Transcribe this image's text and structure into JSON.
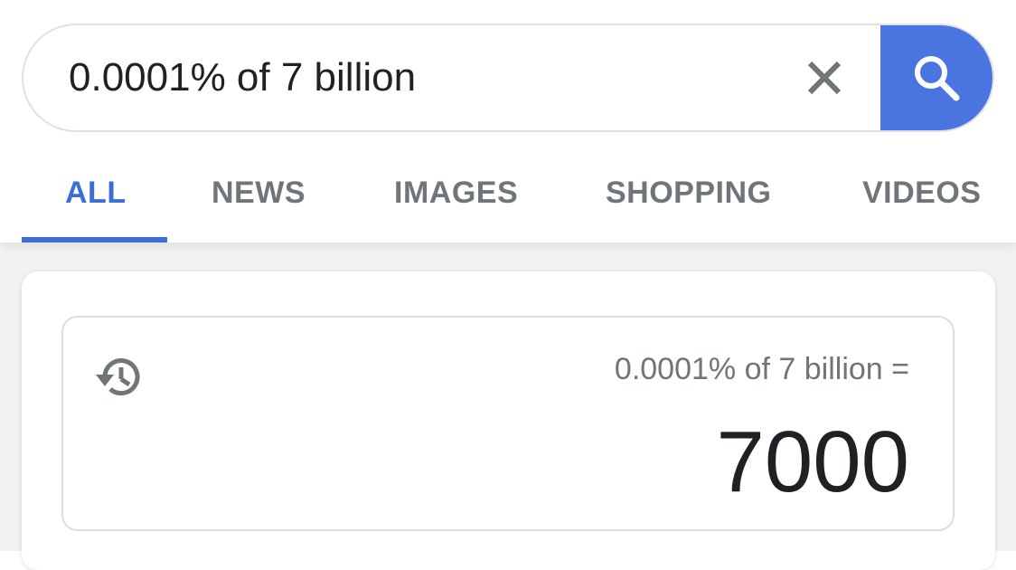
{
  "search": {
    "query": "0.0001% of 7 billion"
  },
  "icons": {
    "clear": "close-icon",
    "search": "search-icon",
    "history": "history-icon"
  },
  "tabs": [
    {
      "label": "ALL",
      "active": true
    },
    {
      "label": "NEWS",
      "active": false
    },
    {
      "label": "IMAGES",
      "active": false
    },
    {
      "label": "SHOPPING",
      "active": false
    },
    {
      "label": "VIDEOS",
      "active": false
    }
  ],
  "calculator": {
    "expression": "0.0001% of 7 billion =",
    "result": "7000"
  },
  "colors": {
    "accent": "#4a74e0",
    "active_tab": "#3c6fd6",
    "inactive_tab": "#70757a"
  }
}
